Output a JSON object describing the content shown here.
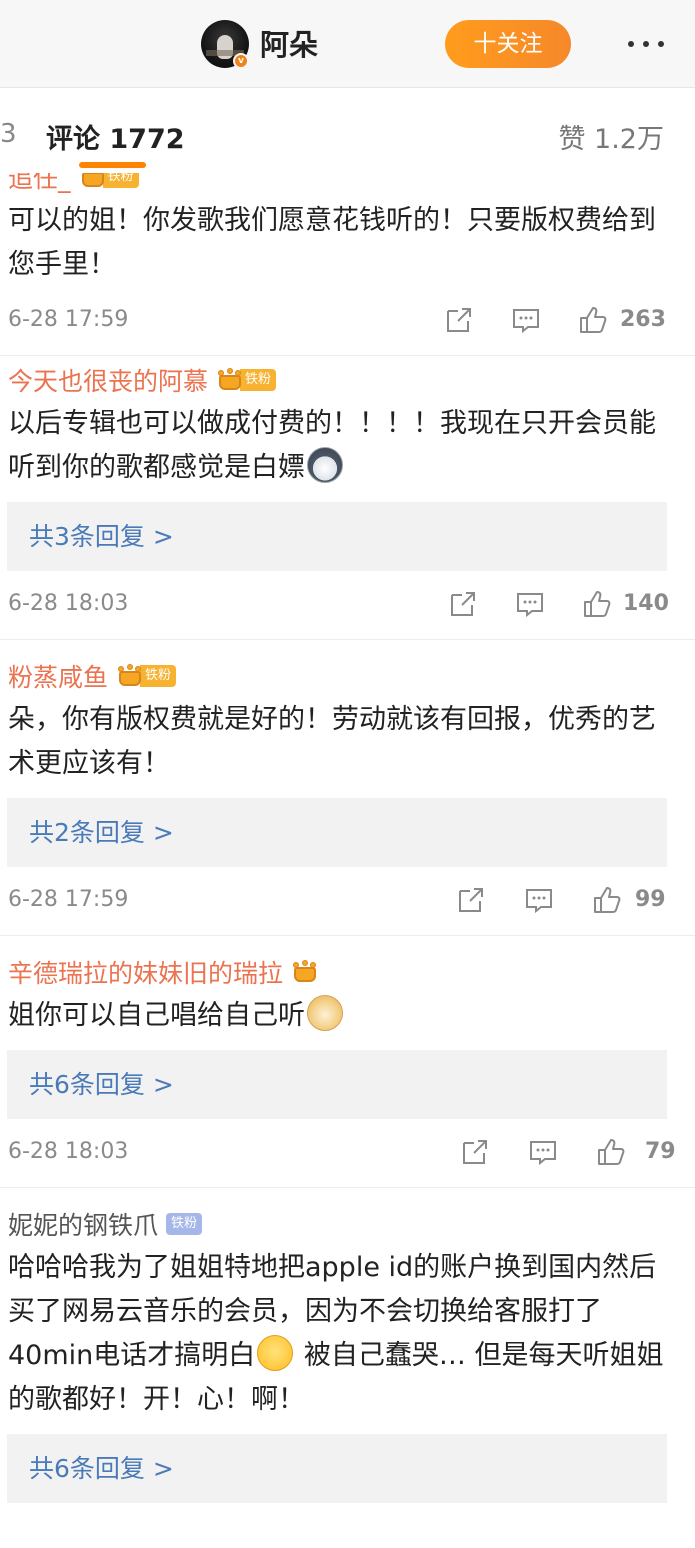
{
  "header": {
    "title": "阿朵",
    "verified_badge": "v",
    "follow_label": "十关注",
    "more_icon": "more-dots-icon"
  },
  "tabs": {
    "prev_count": "3",
    "comments_label": "评论 1772",
    "likes_label": "赞 1.2万",
    "accent_color": "#ff8200"
  },
  "comments": [
    {
      "user": "追任_",
      "fan_badge": "铁粉",
      "content": "可以的姐！你发歌我们愿意花钱听的！只要版权费给到您手里！",
      "replies": "",
      "time": "6-28 17:59",
      "likes": "263"
    },
    {
      "user": "今天也很丧的阿慕",
      "fan_badge": "铁粉",
      "content": "以后专辑也可以做成付费的！！！！我现在只开会员能听到你的歌都感觉是白嫖",
      "emoji": "husky-emoji",
      "replies": "共3条回复 >",
      "time": "6-28 18:03",
      "likes": "140"
    },
    {
      "user": "粉蒸咸鱼",
      "fan_badge": "铁粉",
      "content": "朵，你有版权费就是好的！劳动就该有回报，优秀的艺术更应该有！",
      "replies": "共2条回复 >",
      "time": "6-28 17:59",
      "likes": "99"
    },
    {
      "user": "辛德瑞拉的妹妹旧的瑞拉",
      "fan_badge": "",
      "content": "姐你可以自己唱给自己听",
      "emoji": "doge-emoji",
      "replies": "共6条回复 >",
      "time": "6-28 18:03",
      "likes": "79"
    },
    {
      "user": "妮妮的钢铁爪",
      "fan_badge": "铁粉",
      "content_a": "哈哈哈我为了姐姐特地把apple id的账户换到国内然后买了网易云音乐的会员，因为不会切换给客服打了40min电话才搞明白",
      "emoji": "laugh-cry-emoji",
      "content_b": " 被自己蠢哭… 但是每天听姐姐的歌都好！开！心！啊！",
      "replies": "共6条回复 >"
    }
  ],
  "colors": {
    "username": "#eb7350",
    "reply_link": "#4a7ab8",
    "follow_bg": "#ff9c1c"
  }
}
